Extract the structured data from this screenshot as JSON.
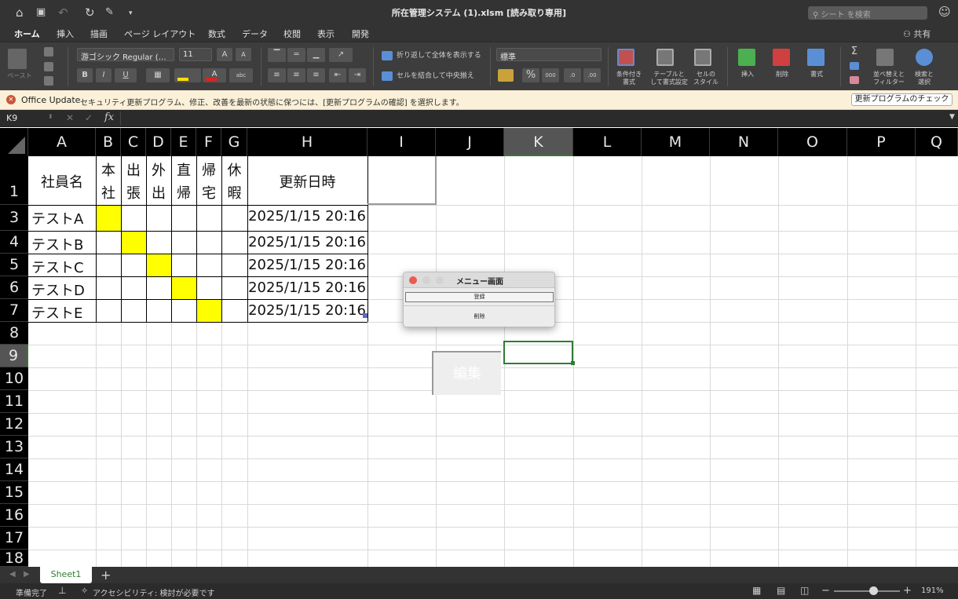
{
  "window": {
    "title": "所在管理システム (1).xlsm  [読み取り専用]",
    "search_placeholder": "シート を検索"
  },
  "ribbon": {
    "tabs": [
      "ホーム",
      "挿入",
      "描画",
      "ページ レイアウト",
      "数式",
      "データ",
      "校閲",
      "表示",
      "開発"
    ],
    "active_tab": "ホーム",
    "share_label": "共有",
    "paste_label": "ペースト",
    "font_name": "游ゴシック Regular (…",
    "font_size": "11",
    "bold": "B",
    "italic": "I",
    "underline": "U",
    "wrap_text": "折り返して全体を表示する",
    "merge_center": "セルを結合して中央揃え",
    "number_format": "標準",
    "percent": "%",
    "comma": "000",
    "conditional_format": [
      "条件付き",
      "書式"
    ],
    "table_format": [
      "テーブルと",
      "して書式設定"
    ],
    "cell_style": [
      "セルの",
      "スタイル"
    ],
    "insert": "挿入",
    "delete": "削除",
    "format": "書式",
    "sort_filter": [
      "並べ替えと",
      "フィルター"
    ],
    "find_select": [
      "検索と",
      "選択"
    ]
  },
  "message_bar": {
    "title": "Office Update",
    "text": "セキュリティ更新プログラム、修正、改善を最新の状態に保つには、[更新プログラムの確認] を選択します。",
    "button": "更新プログラムのチェック"
  },
  "formula_bar": {
    "name_box": "K9",
    "fx": "fx",
    "formula": ""
  },
  "sheet": {
    "columns": [
      "A",
      "B",
      "C",
      "D",
      "E",
      "F",
      "G",
      "H",
      "I",
      "J",
      "K",
      "L",
      "M",
      "N",
      "O",
      "P",
      "Q"
    ],
    "rows": [
      "1",
      "3",
      "4",
      "5",
      "6",
      "7",
      "8",
      "9",
      "10",
      "11",
      "12",
      "13",
      "14",
      "15",
      "16",
      "17",
      "18"
    ],
    "selected_column": "K",
    "selected_row": "9",
    "header": {
      "name": "社員名",
      "statuses": [
        [
          "本",
          "社"
        ],
        [
          "出",
          "張"
        ],
        [
          "外",
          "出"
        ],
        [
          "直",
          "帰"
        ],
        [
          "帰",
          "宅"
        ],
        [
          "休",
          "暇"
        ]
      ],
      "updated": "更新日時"
    },
    "employees": [
      {
        "name": "テストA",
        "status_index": 0,
        "updated": "2025/1/15 20:16"
      },
      {
        "name": "テストB",
        "status_index": 1,
        "updated": "2025/1/15 20:16"
      },
      {
        "name": "テストC",
        "status_index": 2,
        "updated": "2025/1/15 20:16"
      },
      {
        "name": "テストD",
        "status_index": 3,
        "updated": "2025/1/15 20:16"
      },
      {
        "name": "テストE",
        "status_index": 4,
        "updated": "2025/1/15 20:16"
      }
    ],
    "highlight_color": "#ffff00"
  },
  "edit_button": {
    "label": "編集"
  },
  "menu_form": {
    "title": "メニュー画面",
    "register_button": "登録",
    "delete_button": "削除"
  },
  "sheet_tabs": {
    "active": "Sheet1",
    "add": "+"
  },
  "status_bar": {
    "ready": "準備完了",
    "accessibility": "アクセシビリティ: 検討が必要です",
    "zoom": "191%",
    "minus": "−",
    "plus": "+"
  },
  "colors": {
    "accent_green": "#2e7d32",
    "ribbon_dark": "#333333",
    "message_bg": "#fbf0d8"
  }
}
